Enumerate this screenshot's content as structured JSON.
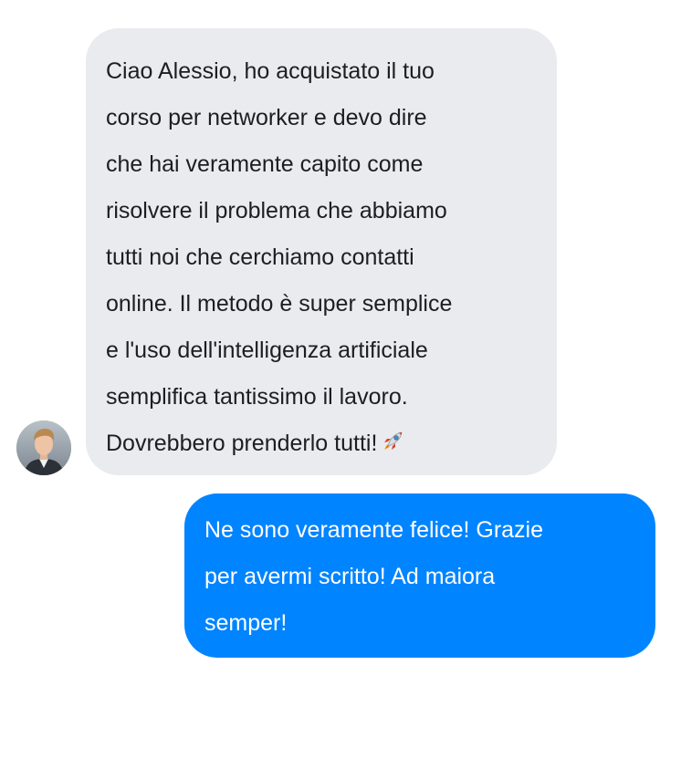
{
  "conversation": {
    "incoming": {
      "sender_avatar_icon": "avatar-photo",
      "lines": [
        "Ciao Alessio, ho acquistato il tuo",
        "corso per networker e devo dire",
        "che hai veramente capito come",
        "risolvere il problema che abbiamo",
        "tutti noi che cerchiamo contatti",
        "online. Il metodo è super semplice",
        "e l'uso dell'intelligenza artificiale",
        "semplifica tantissimo il lavoro.",
        "Dovrebbero prenderlo tutti!"
      ],
      "emoji_icon": "rocket-icon",
      "bubble_color": "#e9ebee",
      "text_color": "#1c1e21"
    },
    "outgoing": {
      "lines": [
        "Ne sono veramente felice! Grazie",
        "per avermi scritto! Ad maiora",
        "semper!"
      ],
      "bubble_color": "#0084ff",
      "text_color": "#ffffff"
    }
  }
}
